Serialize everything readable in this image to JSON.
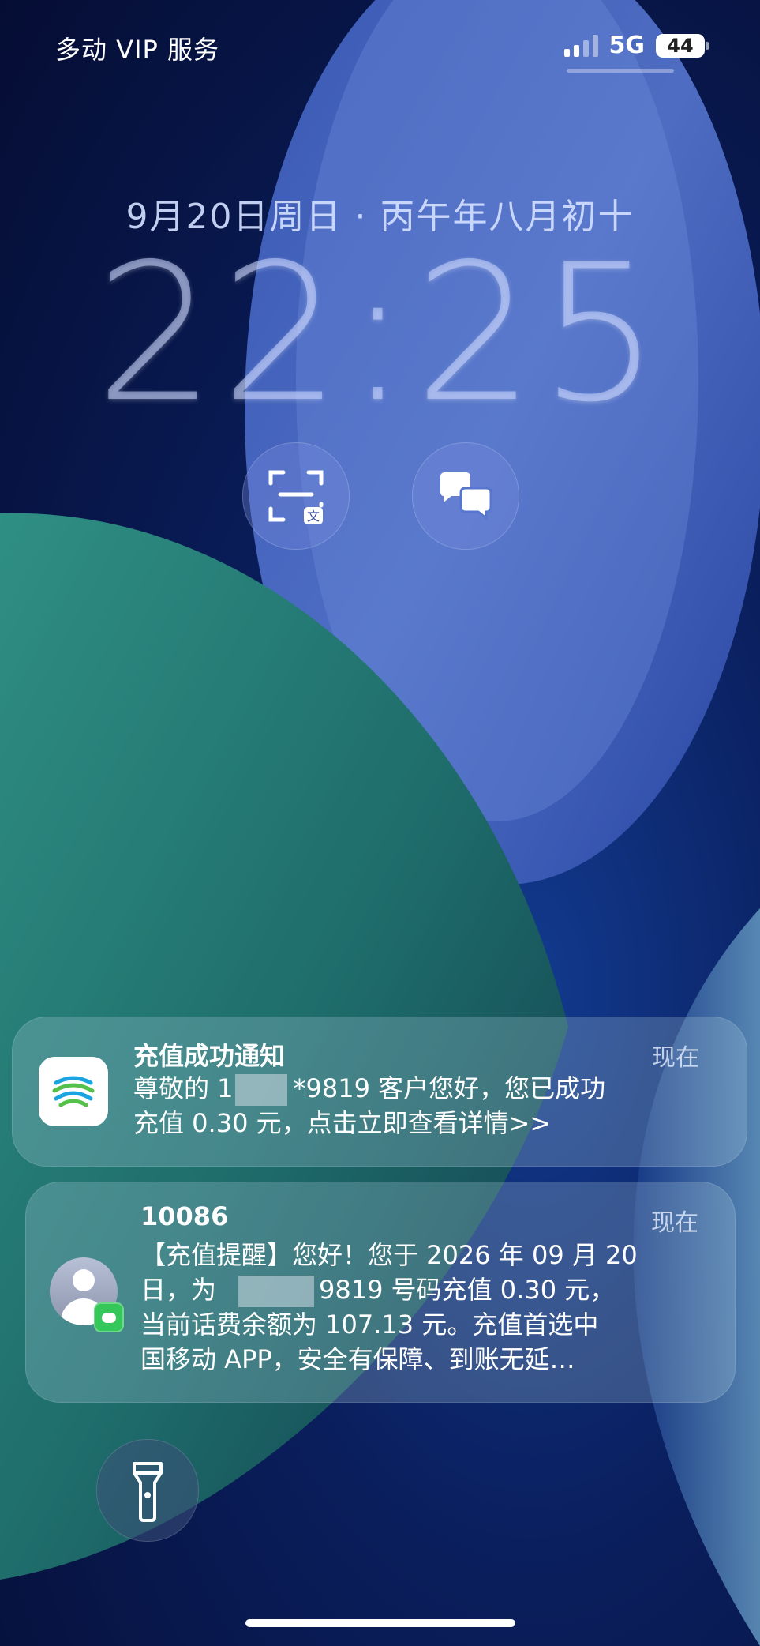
{
  "status_bar": {
    "carrier": "多动 VIP 服务",
    "network": "5G",
    "battery": "44"
  },
  "lock_screen": {
    "date": "9月20日周日 · 丙午年八月初十",
    "time": "22:25"
  },
  "widgets": {
    "left_icon": "scan-translate-icon",
    "right_icon": "translate-icon"
  },
  "notifications": [
    {
      "title": "充值成功通知",
      "time": "现在",
      "line1_pre": "尊敬的 1",
      "line1_post": "*9819 客户您好，您已成功",
      "line2": "充值 0.30 元，点击立即查看详情>>"
    },
    {
      "title": "10086",
      "time": "现在",
      "line1": "【充值提醒】您好！您于 2026 年 09 月 20",
      "line2_pre": "日，为",
      "line2_post": "9819 号码充值 0.30 元，",
      "line3": "当前话费余额为 107.13 元。充值首选中",
      "line4": "国移动 APP，安全有保障、到账无延…"
    }
  ],
  "controls": {
    "flashlight_icon": "flashlight-icon"
  }
}
